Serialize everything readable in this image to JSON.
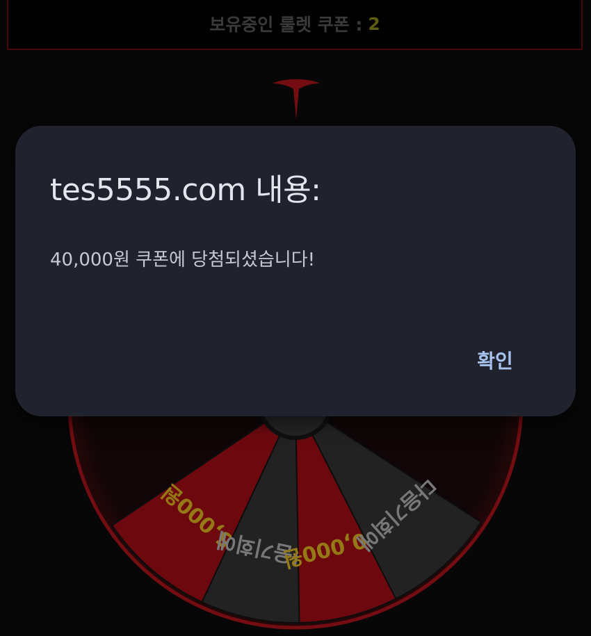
{
  "coupon_bar": {
    "label": "보유중인 룰렛 쿠폰 :",
    "count": "2"
  },
  "roulette": {
    "segments": [
      {
        "label": "5,000원",
        "color": "#a80e16",
        "text_color": "#e3bb22"
      },
      {
        "label": "다음기회에",
        "color": "#363536",
        "text_color": "#b9b9b9"
      },
      {
        "label": "20,000원",
        "color": "#a80e16",
        "text_color": "#e3bb22"
      },
      {
        "label": "다음기회에",
        "color": "#363536",
        "text_color": "#b9b9b9"
      }
    ]
  },
  "dialog": {
    "title": "tes5555.com 내용:",
    "message": "40,000원 쿠폰에 당첨되셨습니다!",
    "ok_label": "확인"
  }
}
